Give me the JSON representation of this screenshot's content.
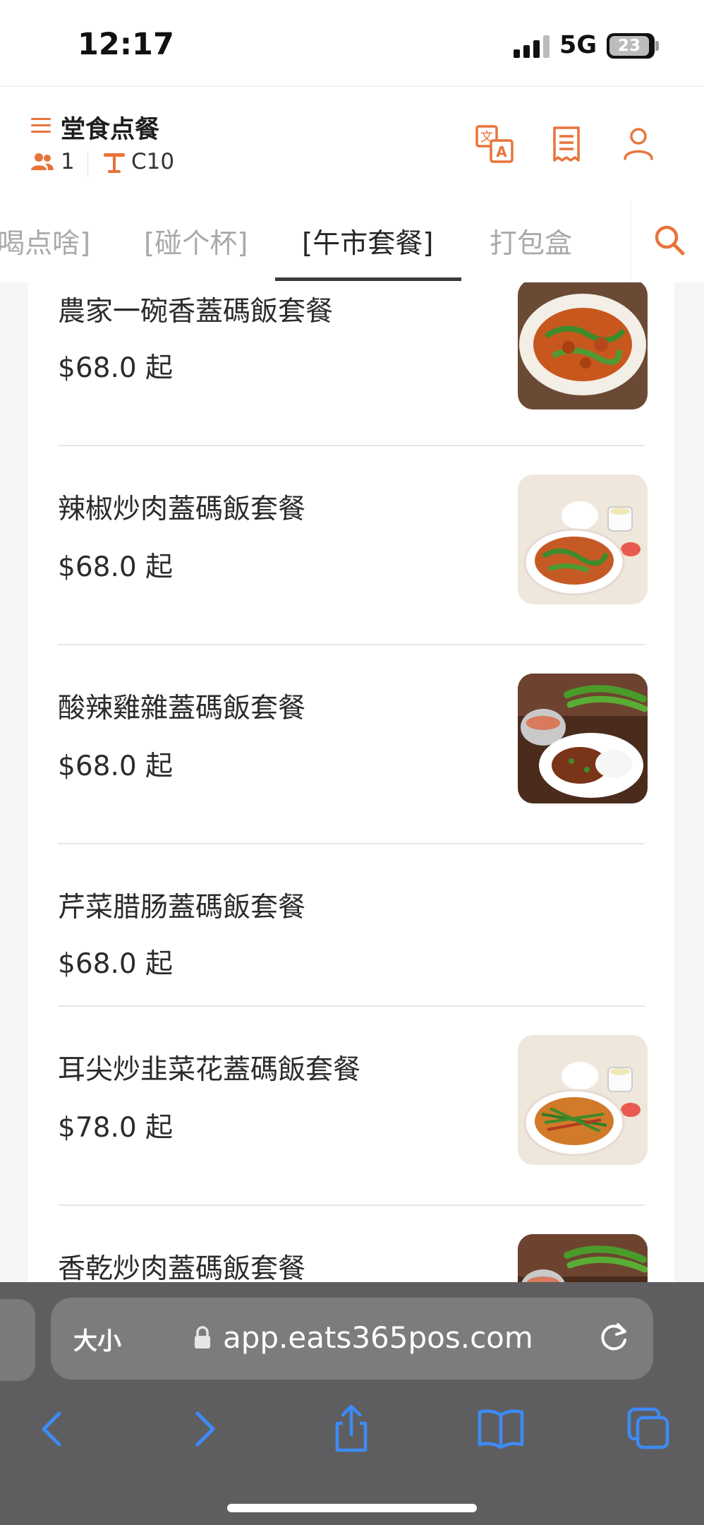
{
  "status_bar": {
    "time": "12:17",
    "network": "5G",
    "battery": "23"
  },
  "header": {
    "title": "堂食点餐",
    "guests": "1",
    "table": "C10",
    "icons": [
      "menu-icon",
      "people-icon",
      "table-icon",
      "translate-icon",
      "receipt-icon",
      "user-icon"
    ]
  },
  "tabs": [
    {
      "label": "喝点啥]",
      "active": false
    },
    {
      "label": "[碰个杯]",
      "active": false
    },
    {
      "label": "[午市套餐]",
      "active": true
    },
    {
      "label": "打包盒",
      "active": false
    }
  ],
  "dishes": [
    {
      "name": "農家一碗香蓋碼飯套餐",
      "price": "$68.0 起",
      "has_image": true
    },
    {
      "name": "辣椒炒肉蓋碼飯套餐",
      "price": "$68.0 起",
      "has_image": true
    },
    {
      "name": "酸辣雞雜蓋碼飯套餐",
      "price": "$68.0 起",
      "has_image": true
    },
    {
      "name": "芹菜腊肠蓋碼飯套餐",
      "price": "$68.0 起",
      "has_image": false
    },
    {
      "name": "耳尖炒韭菜花蓋碼飯套餐",
      "price": "$78.0 起",
      "has_image": true
    },
    {
      "name": "香乾炒肉蓋碼飯套餐",
      "price": "",
      "has_image": true
    }
  ],
  "browser": {
    "size_button": "大小",
    "url": "app.eats365pos.com",
    "toolbar_icons": [
      "back-icon",
      "forward-icon",
      "share-icon",
      "bookmarks-icon",
      "tabs-icon"
    ]
  },
  "colors": {
    "accent": "#e8743b",
    "safari_blue": "#3d8bf7"
  }
}
